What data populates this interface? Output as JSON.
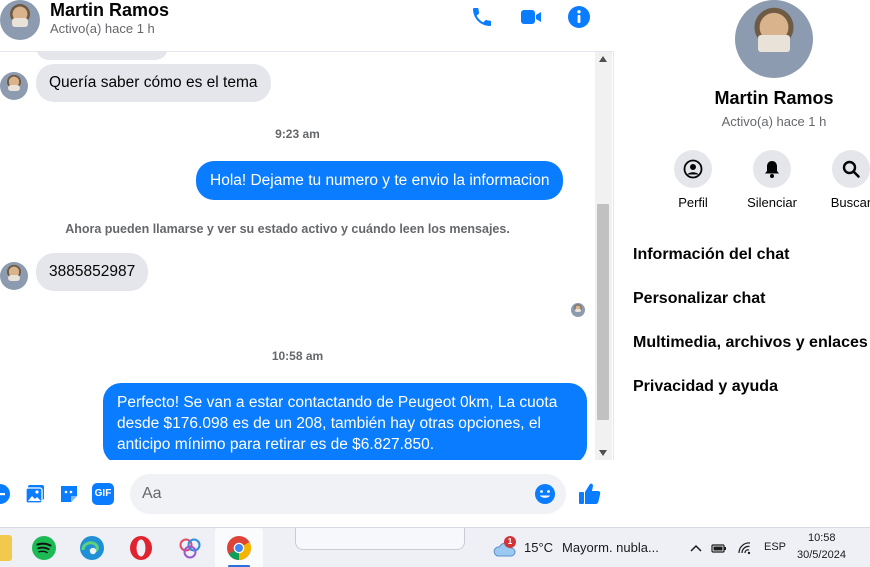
{
  "header": {
    "name": "Martin Ramos",
    "status": "Activo(a) hace 1 h"
  },
  "messages": {
    "msg1": "Quería saber cómo es el tema",
    "time1": "9:23 am",
    "reply1": "Hola! Dejame tu numero y te envio la informacion",
    "system_note": "Ahora pueden llamarse y ver su estado activo y cuándo leen los mensajes.",
    "msg2": "3885852987",
    "time2": "10:58 am",
    "reply2": "Perfecto!  Se van a estar contactando de Peugeot 0km, La cuota desde $176.098 es de un 208, también hay otras opciones, el anticipo mínimo para retirar es de $6.827.850."
  },
  "composer": {
    "placeholder": "Aa",
    "gif_label": "GIF"
  },
  "panel": {
    "name": "Martin Ramos",
    "status": "Activo(a) hace 1 h",
    "actions": [
      {
        "label": "Perfil",
        "icon": "profile-icon"
      },
      {
        "label": "Silenciar",
        "icon": "bell-icon"
      },
      {
        "label": "Buscar",
        "icon": "search-icon"
      }
    ],
    "items": [
      "Información del chat",
      "Personalizar chat",
      "Multimedia, archivos y enlaces",
      "Privacidad y ayuda"
    ]
  },
  "taskbar": {
    "weather_badge": "1",
    "weather_temp": "15°C",
    "weather_desc": "Mayorm. nubla...",
    "language": "ESP",
    "time": "10:58",
    "date": "30/5/2024"
  },
  "colors": {
    "accent": "#0a7cff",
    "bubble_in": "#e4e6eb",
    "muted_text": "#65676b"
  }
}
